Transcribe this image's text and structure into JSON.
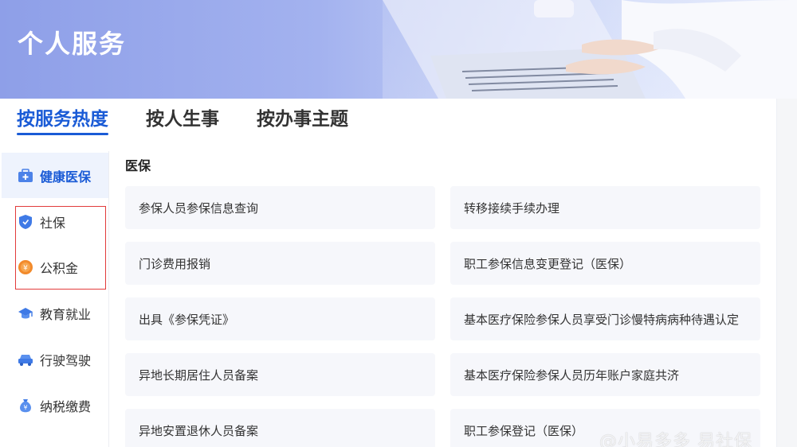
{
  "banner": {
    "title": "个人服务"
  },
  "tabs": [
    {
      "label": "按服务热度",
      "active": true
    },
    {
      "label": "按人生事",
      "active": false
    },
    {
      "label": "按办事主题",
      "active": false
    }
  ],
  "sidebar": {
    "items": [
      {
        "label": "健康医保",
        "icon": "medical-kit-icon",
        "active": true
      },
      {
        "label": "社保",
        "icon": "shield-icon"
      },
      {
        "label": "公积金",
        "icon": "coin-icon"
      },
      {
        "label": "教育就业",
        "icon": "graduation-cap-icon"
      },
      {
        "label": "行驶驾驶",
        "icon": "car-icon"
      },
      {
        "label": "纳税缴费",
        "icon": "money-bag-icon"
      }
    ]
  },
  "main": {
    "section_title": "医保",
    "services": [
      "参保人员参保信息查询",
      "转移接续手续办理",
      "门诊费用报销",
      "职工参保信息变更登记（医保）",
      "出具《参保凭证》",
      "基本医疗保险参保人员享受门诊慢特病病种待遇认定",
      "异地长期居住人员备案",
      "基本医疗保险参保人员历年账户家庭共济",
      "异地安置退休人员备案",
      "职工参保登记（医保）"
    ]
  },
  "watermark": "@小易多多 易社保",
  "colors": {
    "accent": "#1a5bd6",
    "highlight": "#e23b3b",
    "card_bg": "#f6f7fb"
  }
}
